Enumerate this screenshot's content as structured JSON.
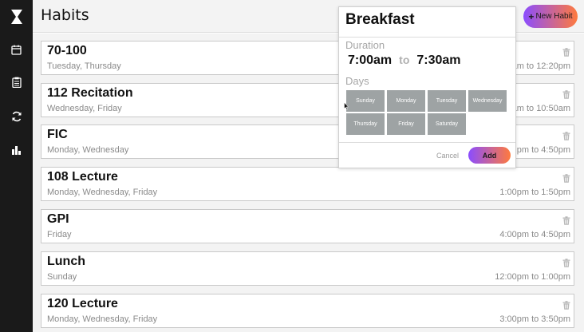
{
  "app": {
    "title": "Habits",
    "logo_icon": "hourglass-icon"
  },
  "sidebar": {
    "items": [
      {
        "icon": "calendar-icon"
      },
      {
        "icon": "clipboard-icon"
      },
      {
        "icon": "refresh-icon"
      },
      {
        "icon": "bar-chart-icon"
      }
    ]
  },
  "header": {
    "new_habit_label": "New Habit",
    "new_habit_plus": "+"
  },
  "habits": [
    {
      "name": "70-100",
      "days": "Tuesday, Thursday",
      "time": "am to 12:20pm"
    },
    {
      "name": "112 Recitation",
      "days": "Wednesday, Friday",
      "time": "am to 10:50am"
    },
    {
      "name": "FIC",
      "days": "Monday, Wednesday",
      "time": "pm to 4:50pm"
    },
    {
      "name": "108 Lecture",
      "days": "Monday, Wednesday, Friday",
      "time": "1:00pm to 1:50pm"
    },
    {
      "name": "GPI",
      "days": "Friday",
      "time": "4:00pm to 4:50pm"
    },
    {
      "name": "Lunch",
      "days": "Sunday",
      "time": "12:00pm to 1:00pm"
    },
    {
      "name": "120 Lecture",
      "days": "Monday, Wednesday, Friday",
      "time": "3:00pm to 3:50pm"
    }
  ],
  "modal": {
    "title": "Breakfast",
    "duration_label": "Duration",
    "start_time": "7:00am",
    "to_label": "to",
    "end_time": "7:30am",
    "days_label": "Days",
    "days": [
      "Sunday",
      "Monday",
      "Tuesday",
      "Wednesday",
      "Thursday",
      "Friday",
      "Saturday"
    ],
    "cancel_label": "Cancel",
    "add_label": "Add"
  },
  "colors": {
    "sidebar_bg": "#1a1a1a",
    "gradient_start": "#8b4dff",
    "gradient_end": "#ff7a3d",
    "day_button": "#9ea3a4"
  }
}
